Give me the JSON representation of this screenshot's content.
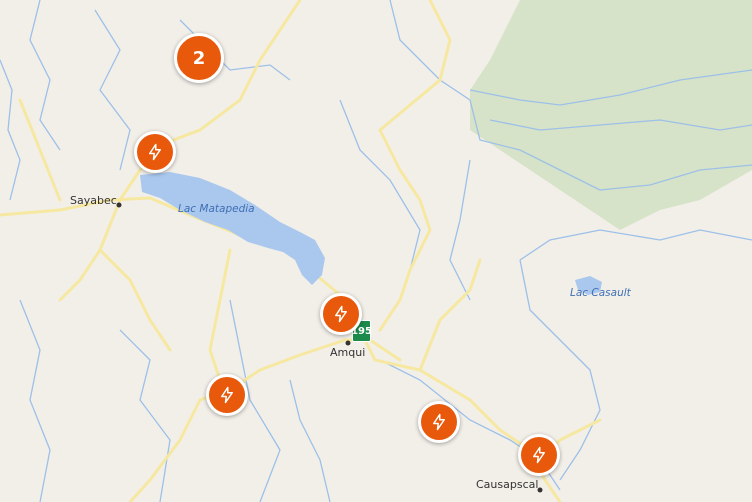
{
  "map": {
    "places": [
      {
        "id": "sayabec",
        "name": "Sayabec"
      },
      {
        "id": "amqui",
        "name": "Amqui"
      },
      {
        "id": "causapscal",
        "name": "Causapscal"
      }
    ],
    "water_labels": [
      {
        "id": "lac-matapedia",
        "name": "Lac Matapedia"
      },
      {
        "id": "lac-casault",
        "name": "Lac Casault"
      }
    ],
    "route_shield": {
      "number": "195",
      "color": "#1b8a4a"
    },
    "cluster": {
      "count": "2",
      "color": "#e8590c"
    },
    "markers": [
      {
        "icon": "lightning-bolt-icon"
      },
      {
        "icon": "lightning-bolt-icon"
      },
      {
        "icon": "lightning-bolt-icon"
      },
      {
        "icon": "lightning-bolt-icon"
      },
      {
        "icon": "lightning-bolt-icon"
      }
    ],
    "colors": {
      "land": "#f2efe9",
      "water": "#aac8ee",
      "park": "#d7e3c8",
      "road": "#f6e8a0",
      "river": "#9dc0e8",
      "marker": "#e8590c"
    }
  }
}
